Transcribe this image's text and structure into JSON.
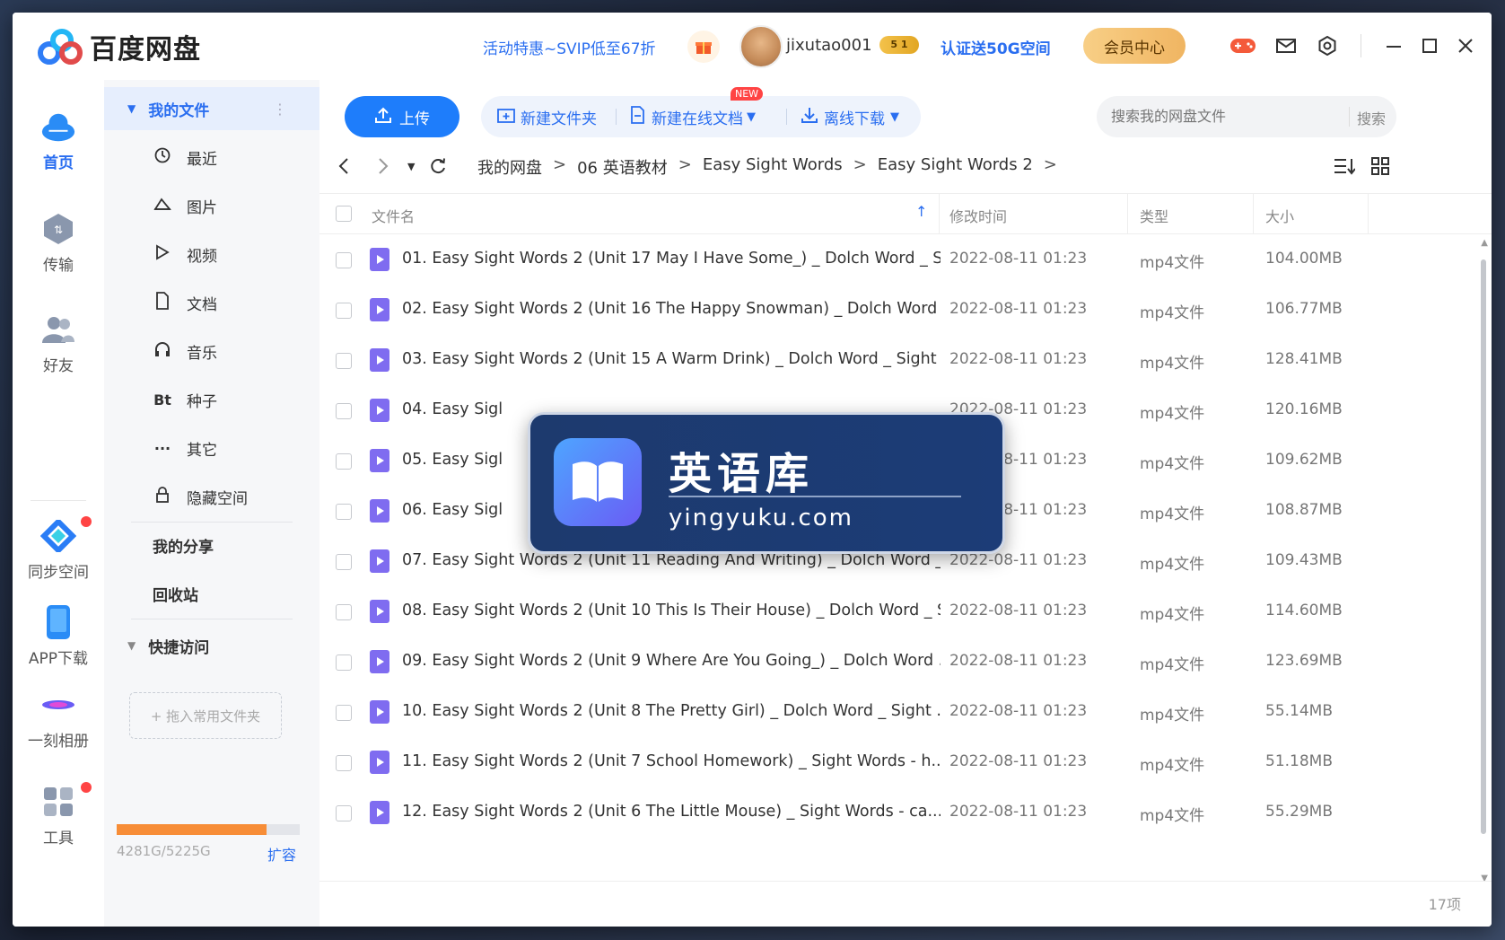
{
  "app": {
    "name": "百度网盘"
  },
  "header": {
    "promo": "活动特惠~SVIP低至67折",
    "username": "jixutao001",
    "vip_badge": "5  1",
    "verify": "认证送50G空间",
    "member_center": "会员中心"
  },
  "leftnav": {
    "items": [
      {
        "label": "首页"
      },
      {
        "label": "传输"
      },
      {
        "label": "好友"
      },
      {
        "label": "同步空间"
      },
      {
        "label": "APP下载"
      },
      {
        "label": "一刻相册"
      },
      {
        "label": "工具"
      }
    ]
  },
  "sidebar": {
    "my_files": "我的文件",
    "items": [
      {
        "label": "最近",
        "icon": "clock-icon"
      },
      {
        "label": "图片",
        "icon": "image-icon"
      },
      {
        "label": "视频",
        "icon": "play-icon"
      },
      {
        "label": "文档",
        "icon": "document-icon"
      },
      {
        "label": "音乐",
        "icon": "headphones-icon"
      },
      {
        "label": "种子",
        "icon_text": "Bt"
      },
      {
        "label": "其它",
        "icon_text": "···"
      },
      {
        "label": "隐藏空间",
        "icon": "lock-icon"
      }
    ],
    "my_share": "我的分享",
    "recycle": "回收站",
    "quick_access": "快捷访问",
    "drop_folder": "+ 拖入常用文件夹",
    "storage_text": "4281G/5225G",
    "storage_used_fraction": 0.819,
    "expand": "扩容"
  },
  "toolbar": {
    "upload": "上传",
    "new_folder": "新建文件夹",
    "new_online_doc": "新建在线文档",
    "new_badge": "NEW",
    "offline_download": "离线下载",
    "search_placeholder": "搜索我的网盘文件",
    "search_button": "搜索"
  },
  "breadcrumb": [
    "我的网盘",
    "06 英语教材",
    "Easy Sight Words",
    "Easy Sight Words 2"
  ],
  "table": {
    "headers": {
      "name": "文件名",
      "modified": "修改时间",
      "type": "类型",
      "size": "大小"
    },
    "rows": [
      {
        "name": "01. Easy Sight Words 2 (Unit 17 May I Have Some_) _ Dolch Word _ Si...",
        "date": "2022-08-11 01:23",
        "type": "mp4文件",
        "size": "104.00MB"
      },
      {
        "name": "02. Easy Sight Words 2 (Unit 16 The Happy Snowman) _ Dolch Word ...",
        "date": "2022-08-11 01:23",
        "type": "mp4文件",
        "size": "106.77MB"
      },
      {
        "name": "03. Easy Sight Words 2 (Unit 15 A Warm Drink) _ Dolch Word _ Sight ...",
        "date": "2022-08-11 01:23",
        "type": "mp4文件",
        "size": "128.41MB"
      },
      {
        "name": "04. Easy Sigl",
        "date": "2022-08-11 01:23",
        "type": "mp4文件",
        "size": "120.16MB"
      },
      {
        "name": "05. Easy Sigl",
        "date": "2022-08-11 01:23",
        "type": "mp4文件",
        "size": "109.62MB"
      },
      {
        "name": "06. Easy Sigl",
        "date": "2022-08-11 01:23",
        "type": "mp4文件",
        "size": "108.87MB"
      },
      {
        "name": "07. Easy Sight Words 2 (Unit 11 Reading And Writing) _ Dolch Word _...",
        "date": "2022-08-11 01:23",
        "type": "mp4文件",
        "size": "109.43MB"
      },
      {
        "name": "08. Easy Sight Words 2 (Unit 10 This Is Their House) _ Dolch Word _ S...",
        "date": "2022-08-11 01:23",
        "type": "mp4文件",
        "size": "114.60MB"
      },
      {
        "name": "09. Easy Sight Words 2 (Unit 9 Where Are You Going_) _ Dolch Word ...",
        "date": "2022-08-11 01:23",
        "type": "mp4文件",
        "size": "123.69MB"
      },
      {
        "name": "10. Easy Sight Words 2 (Unit 8 The Pretty Girl) _ Dolch Word _ Sight ...",
        "date": "2022-08-11 01:23",
        "type": "mp4文件",
        "size": "55.14MB"
      },
      {
        "name": "11. Easy Sight Words 2 (Unit 7 School Homework) _ Sight Words  - h...",
        "date": "2022-08-11 01:23",
        "type": "mp4文件",
        "size": "51.18MB"
      },
      {
        "name": "12. Easy Sight Words 2 (Unit 6 The Little Mouse) _ Sight Words  - ca...",
        "date": "2022-08-11 01:23",
        "type": "mp4文件",
        "size": "55.29MB"
      }
    ],
    "item_count": "17项"
  },
  "watermark": {
    "title": "英语库",
    "url": "yingyuku.com"
  }
}
